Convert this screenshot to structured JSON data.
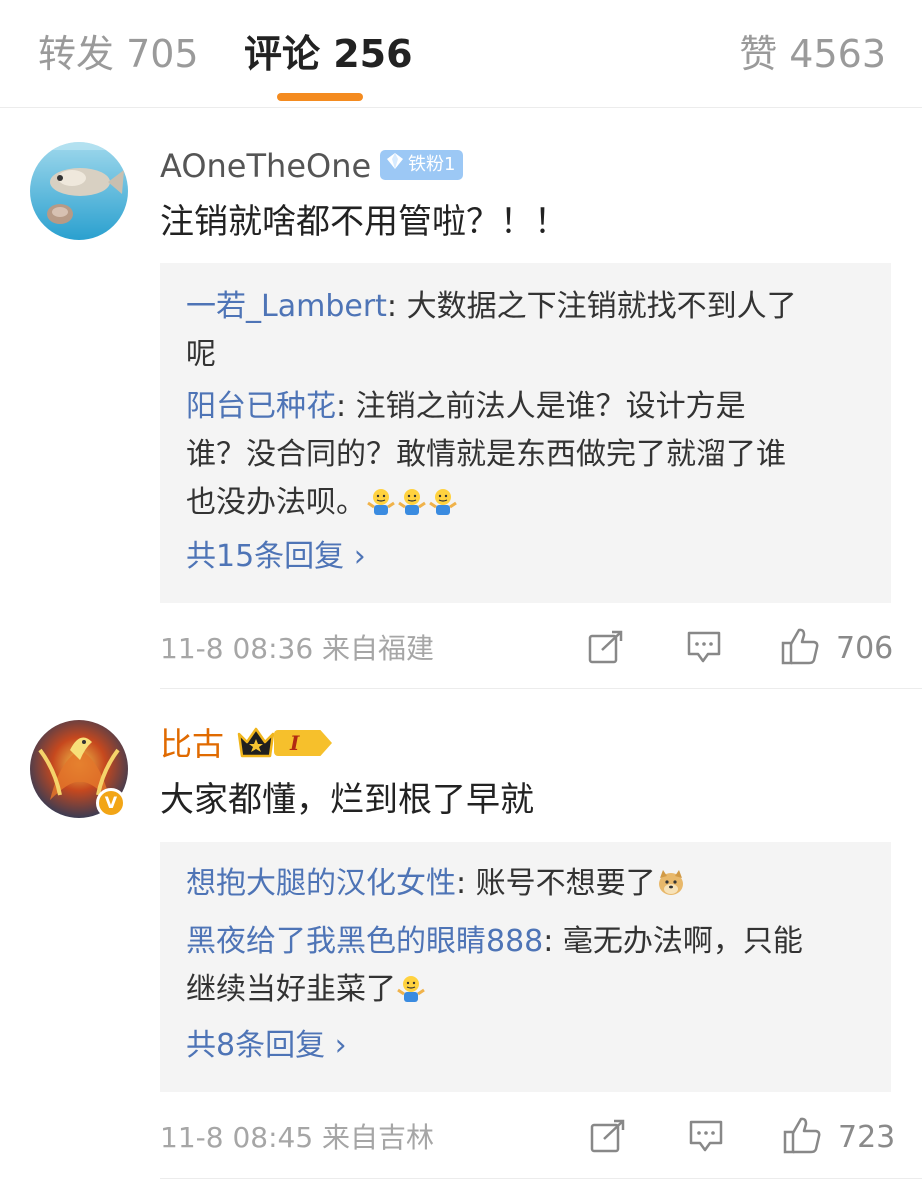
{
  "tabs": {
    "repost": "转发 705",
    "comment": "评论 256",
    "like": "赞 4563"
  },
  "comments": [
    {
      "username": "AOneTheOne",
      "badge": "铁粉1",
      "text": "注销就啥都不用管啦？！！",
      "replies": [
        {
          "name": "一若_Lambert",
          "line1": ": 大数据之下注销就找不到人了",
          "line2": "呢"
        },
        {
          "name": "阳台已种花",
          "line1": ": 注销之前法人是谁？设计方是",
          "line2": "谁？没合同的？敢情就是东西做完了就溜了谁",
          "line3": "也没办法呗。"
        }
      ],
      "more": "共15条回复 ›",
      "time": "11-8 08:36",
      "location": "来自福建",
      "likes": "706"
    },
    {
      "username": "比古",
      "badge_level": "I",
      "verified_mark": "V",
      "text": "大家都懂，烂到根了早就",
      "replies": [
        {
          "name": "想抱大腿的汉化女性",
          "line1": ": 账号不想要了"
        },
        {
          "name": "黑夜给了我黑色的眼睛888",
          "line1": ": 毫无办法啊，只能",
          "line2": "继续当好韭菜了"
        }
      ],
      "more": "共8条回复 ›",
      "time": "11-8 08:45",
      "location": "来自吉林",
      "likes": "723"
    }
  ],
  "colors": {
    "accent": "#f48b1f",
    "link": "#4e74b6",
    "username_gold": "#e06a00",
    "muted": "#a6a6a6"
  },
  "icons": [
    "repost-icon",
    "comment-icon",
    "like-icon",
    "shrug-emoji",
    "doge-emoji",
    "crown-icon",
    "diamond-icon"
  ]
}
